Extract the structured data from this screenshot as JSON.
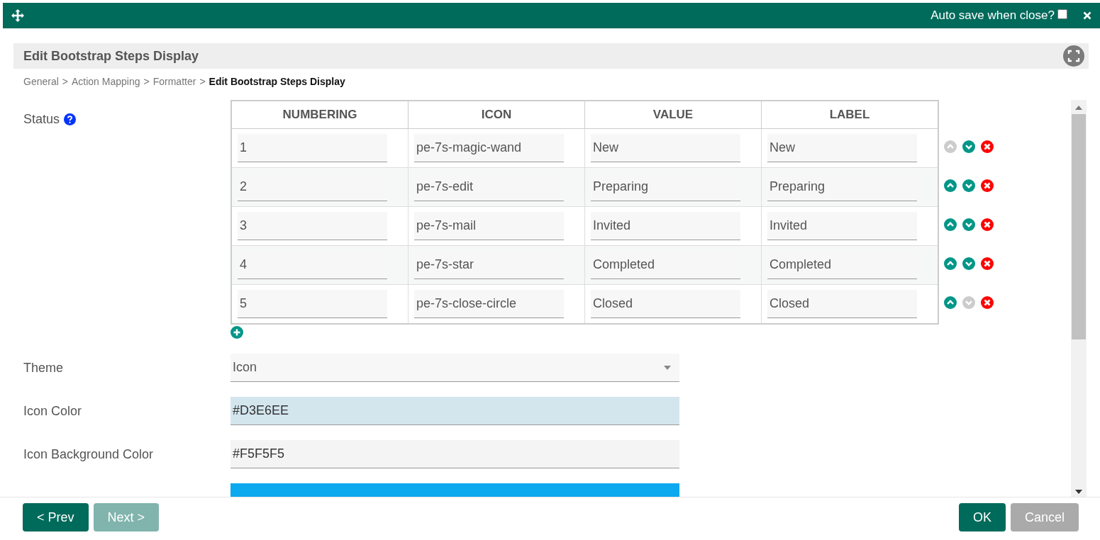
{
  "titlebar": {
    "autosave_label": "Auto save when close?",
    "autosave_checked": false
  },
  "header": {
    "title": "Edit Bootstrap Steps Display"
  },
  "breadcrumb": [
    {
      "label": "General",
      "current": false
    },
    {
      "label": "Action Mapping",
      "current": false
    },
    {
      "label": "Formatter",
      "current": false
    },
    {
      "label": "Edit Bootstrap Steps Display",
      "current": true
    }
  ],
  "breadcrumb_separator": ">",
  "status": {
    "label": "Status",
    "columns": [
      "NUMBERING",
      "ICON",
      "VALUE",
      "LABEL"
    ],
    "rows": [
      {
        "numbering": "1",
        "icon": "pe-7s-magic-wand",
        "value": "New",
        "label": "New",
        "up_disabled": true,
        "down_disabled": false
      },
      {
        "numbering": "2",
        "icon": "pe-7s-edit",
        "value": "Preparing",
        "label": "Preparing",
        "up_disabled": false,
        "down_disabled": false
      },
      {
        "numbering": "3",
        "icon": "pe-7s-mail",
        "value": "Invited",
        "label": "Invited",
        "up_disabled": false,
        "down_disabled": false
      },
      {
        "numbering": "4",
        "icon": "pe-7s-star",
        "value": "Completed",
        "label": "Completed",
        "up_disabled": false,
        "down_disabled": false
      },
      {
        "numbering": "5",
        "icon": "pe-7s-close-circle",
        "value": "Closed",
        "label": "Closed",
        "up_disabled": false,
        "down_disabled": true
      }
    ]
  },
  "fields": [
    {
      "kind": "select",
      "label": "Theme",
      "value": "Icon"
    },
    {
      "kind": "color",
      "label": "Icon Color",
      "value": "#D3E6EE",
      "color": "#d3e6ee"
    },
    {
      "kind": "color",
      "label": "Icon Background Color",
      "value": "#F5F5F5",
      "color": "#f4f4f4"
    },
    {
      "kind": "cut",
      "color": "#0da9ef"
    }
  ],
  "footer": {
    "left": [
      {
        "label": "< Prev",
        "disabled": false
      },
      {
        "label": "Next >",
        "disabled": true
      }
    ],
    "right": [
      {
        "label": "OK",
        "kind": "primary"
      },
      {
        "label": "Cancel",
        "kind": "secondary"
      }
    ]
  }
}
